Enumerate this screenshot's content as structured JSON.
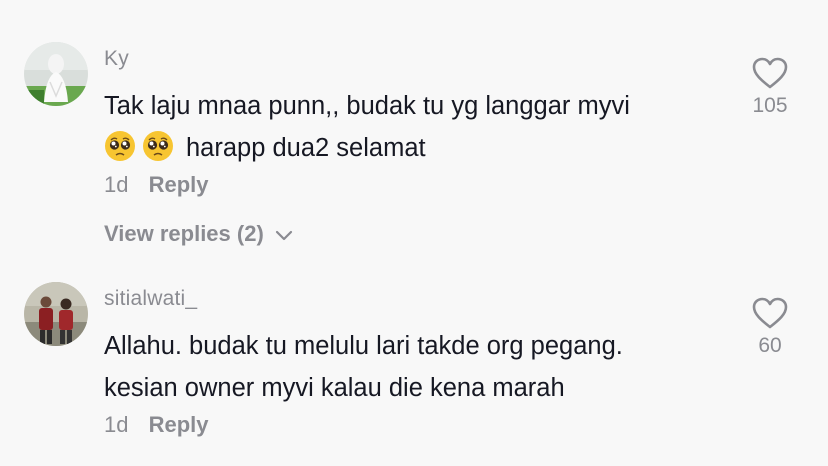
{
  "comments": [
    {
      "username": "Ky",
      "text_line1": "Tak laju mnaa punn,, budak tu yg langgar myvi",
      "text_line2": "harapp dua2 selamat",
      "emoji_icons": [
        "pleading-face-emoji",
        "pleading-face-emoji"
      ],
      "time": "1d",
      "reply_label": "Reply",
      "view_replies_label": "View replies (2)",
      "like_count": "105"
    },
    {
      "username": "sitialwati_",
      "text_line1": "Allahu. budak tu melulu lari takde org pegang.",
      "text_line2": "kesian owner myvi kalau die kena marah",
      "time": "1d",
      "reply_label": "Reply",
      "like_count": "60"
    }
  ],
  "colors": {
    "background": "#f8f8f8",
    "primary_text": "#161823",
    "secondary_text": "#8a8b91"
  }
}
